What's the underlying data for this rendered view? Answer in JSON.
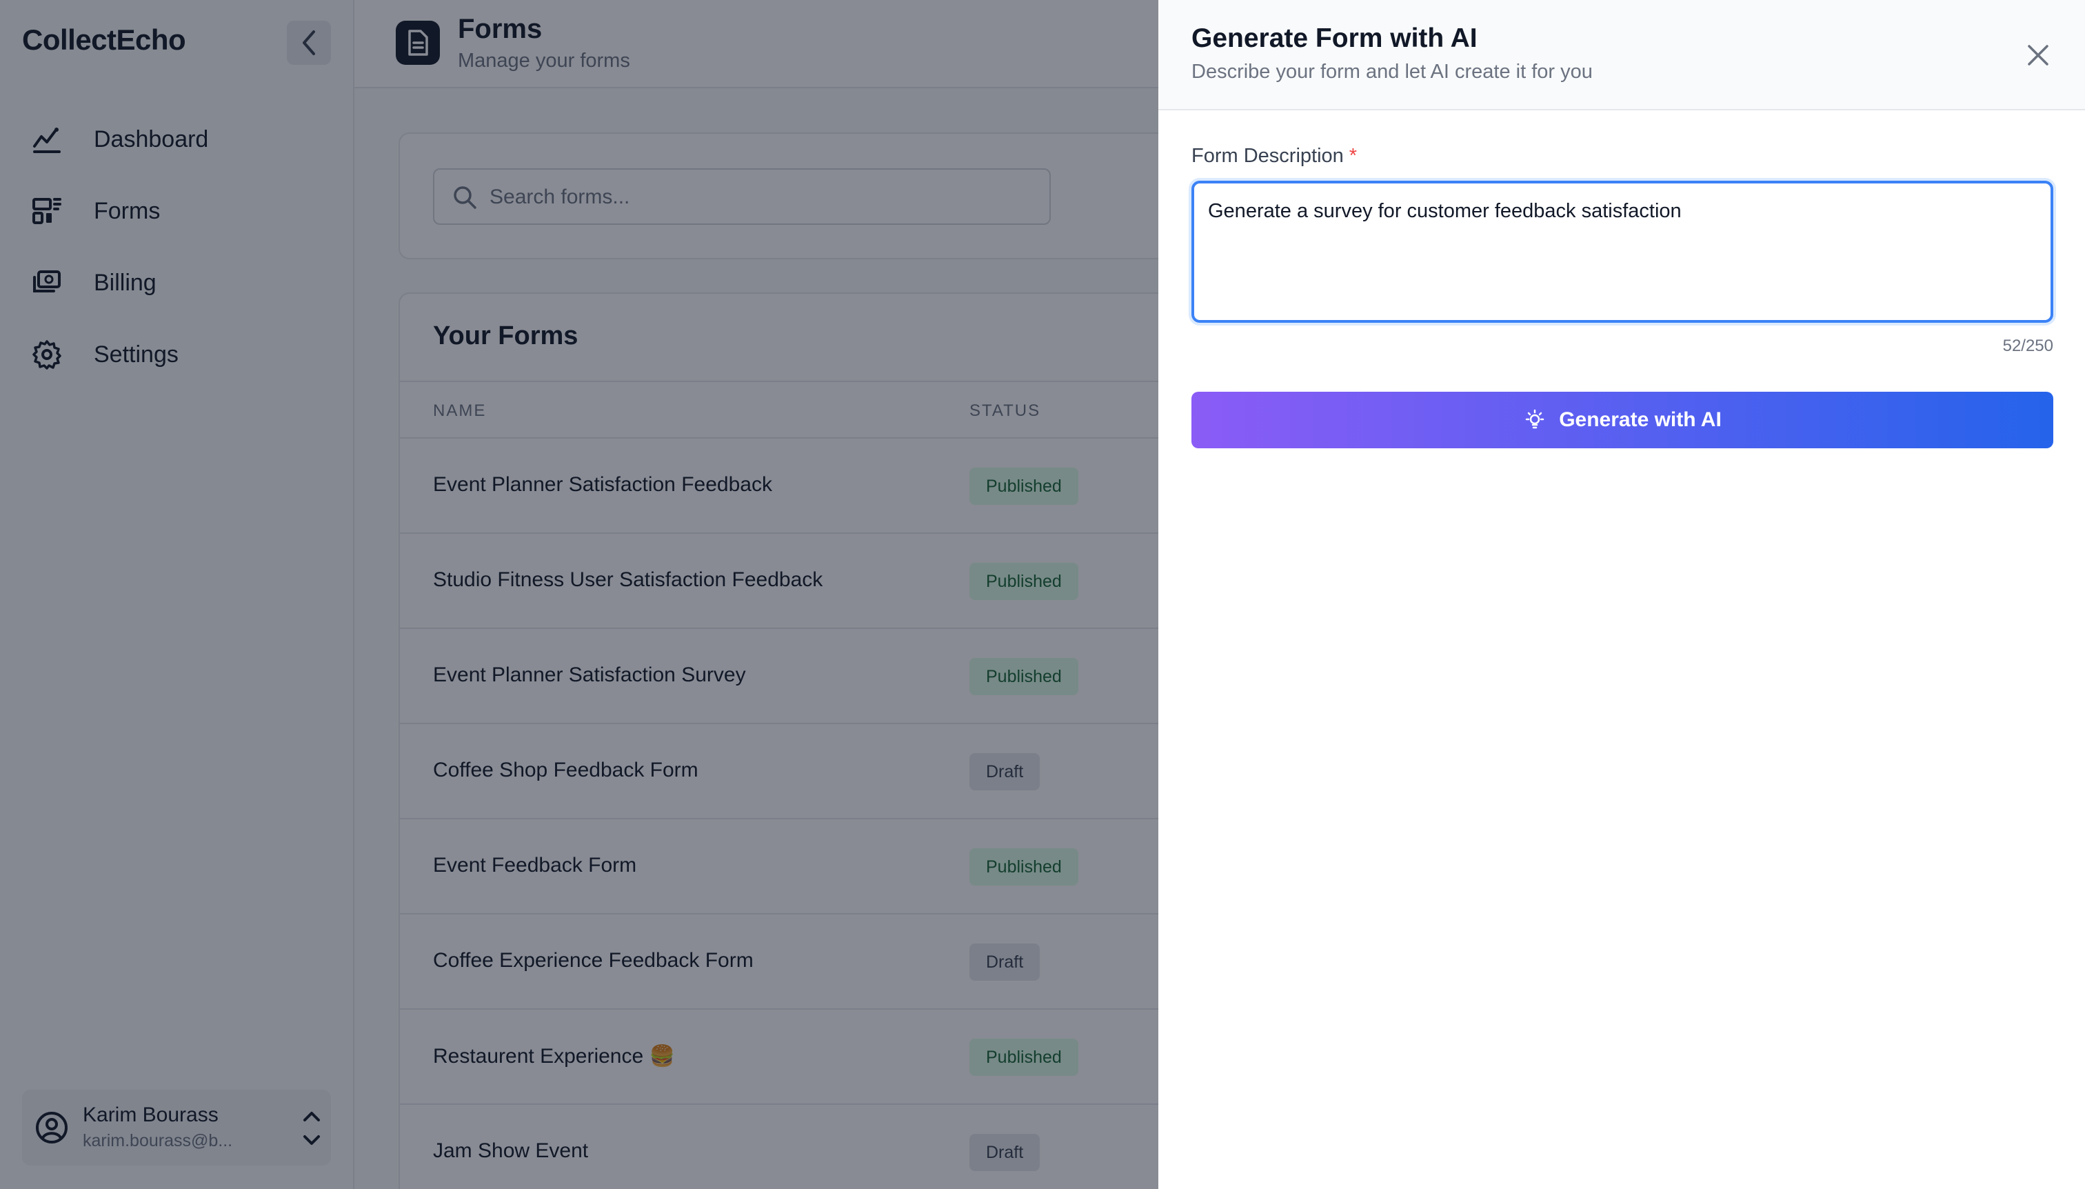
{
  "sidebar": {
    "brand": "CollectEcho",
    "items": [
      {
        "label": "Dashboard",
        "icon": "chart-line-icon"
      },
      {
        "label": "Forms",
        "icon": "forms-icon"
      },
      {
        "label": "Billing",
        "icon": "billing-icon"
      },
      {
        "label": "Settings",
        "icon": "gear-icon"
      }
    ],
    "user": {
      "name": "Karim Bourass",
      "email": "karim.bourass@b..."
    }
  },
  "header": {
    "title": "Forms",
    "subtitle": "Manage your forms"
  },
  "search": {
    "placeholder": "Search forms..."
  },
  "forms": {
    "title": "Your Forms",
    "columns": [
      "NAME",
      "STATUS"
    ],
    "rows": [
      {
        "name": "Event Planner Satisfaction Feedback",
        "status": "Published"
      },
      {
        "name": "Studio Fitness User Satisfaction Feedback",
        "status": "Published"
      },
      {
        "name": "Event Planner Satisfaction Survey",
        "status": "Published"
      },
      {
        "name": "Coffee Shop Feedback Form",
        "status": "Draft"
      },
      {
        "name": "Event Feedback Form",
        "status": "Published"
      },
      {
        "name": "Coffee Experience Feedback Form",
        "status": "Draft"
      },
      {
        "name": "Restaurent Experience 🍔",
        "status": "Published"
      },
      {
        "name": "Jam Show Event",
        "status": "Draft"
      }
    ]
  },
  "panel": {
    "title": "Generate Form with AI",
    "subtitle": "Describe your form and let AI create it for you",
    "field_label": "Form Description",
    "required_mark": "*",
    "description_value": "Generate a survey for customer feedback satisfaction",
    "counter": "52/250",
    "generate_label": "Generate with AI"
  },
  "colors": {
    "accent_start": "#8b5cf6",
    "accent_end": "#2563eb",
    "focus": "#3b82f6",
    "published_bg": "#dcfce7",
    "draft_bg": "#e5e7eb"
  }
}
